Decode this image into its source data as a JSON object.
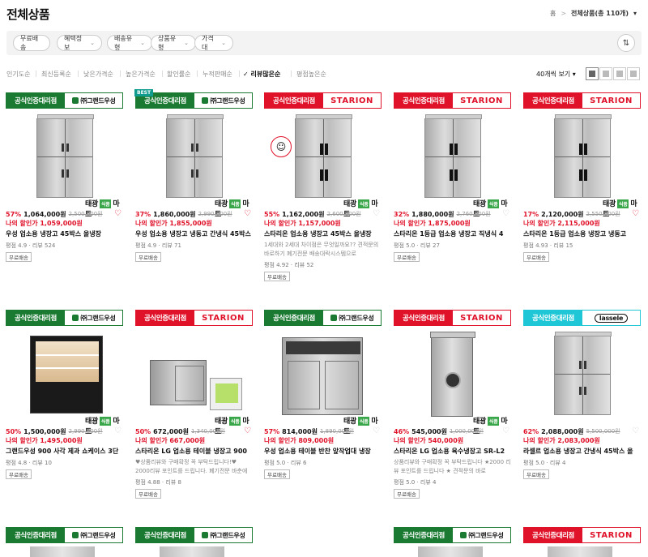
{
  "header": {
    "title": "전체상품",
    "breadcrumb": {
      "home": "홈",
      "sep": ">",
      "current": "전체상품(총 110개)",
      "caret": "▾"
    }
  },
  "filters": {
    "chips": [
      {
        "label": "무료배송",
        "caret": ""
      },
      {
        "label": "혜택정보",
        "caret": "⌄"
      },
      {
        "label": "배송유형",
        "caret": "⌄"
      },
      {
        "label": "상품유형",
        "caret": "⌄"
      },
      {
        "label": "가격대",
        "caret": "⌄"
      }
    ],
    "settings_icon": "⇅"
  },
  "sort": {
    "options": [
      "인기도순",
      "최신등록순",
      "낮은가격순",
      "높은가격순",
      "할인률순",
      "누적판매순",
      "리뷰많은순",
      "평점높은순"
    ],
    "active_check": "✓",
    "per_page": "40개씩 보기 ▾"
  },
  "products": [
    {
      "badge_left": "공식인증대리점",
      "badge_right": "㈜그랜드우성",
      "style": "green",
      "best": "",
      "discount": "57%",
      "price": "1,064,000원",
      "orig": "2,500,000원",
      "my_price": "나의 할인가 1,059,000원",
      "name": "우성 업소용 냉장고 45박스 올냉장",
      "desc": "",
      "rating": "평점 4.9 · 리뷰 524",
      "ship": "무료배송",
      "heart": "♡",
      "heart_on": true
    },
    {
      "badge_left": "공식인증대리점",
      "badge_right": "㈜그랜드우성",
      "style": "green",
      "best": "BEST",
      "discount": "37%",
      "price": "1,860,000원",
      "orig": "2,990,000원",
      "my_price": "나의 할인가 1,855,000원",
      "name": "우성 업소용 냉장고 냉동고 간냉식 45박스",
      "desc": "",
      "rating": "평점 4.9 · 리뷰 71",
      "ship": "무료배송",
      "heart": "♡",
      "heart_on": true
    },
    {
      "badge_left": "공식인증대리점",
      "badge_right": "STARION",
      "style": "red",
      "best": "",
      "discount": "55%",
      "price": "1,162,000원",
      "orig": "2,600,000원",
      "my_price": "나의 할인가 1,157,000원",
      "name": "스타리온 업소용 냉장고 45박스 올냉장",
      "desc": "1세대와 2세대 차이점은 무엇일까요?? 견적문의 바로하기 폐기전문 배송대락시스템으로",
      "rating": "평점 4.92 · 리뷰 52",
      "ship": "무료배송",
      "heart": "♡",
      "heart_on": false
    },
    {
      "badge_left": "공식인증대리점",
      "badge_right": "STARION",
      "style": "red",
      "best": "",
      "discount": "32%",
      "price": "1,880,000원",
      "orig": "2,760,000원",
      "my_price": "나의 할인가 1,875,000원",
      "name": "스타리온 1등급 업소용 냉장고 직냉식 4",
      "desc": "",
      "rating": "평점 5.0 · 리뷰 27",
      "ship": "무료배송",
      "heart": "♡",
      "heart_on": false
    },
    {
      "badge_left": "공식인증대리점",
      "badge_right": "STARION",
      "style": "red",
      "best": "",
      "discount": "17%",
      "price": "2,120,000원",
      "orig": "2,550,000원",
      "my_price": "나의 할인가 2,115,000원",
      "name": "스타리온 1등급 업소용 냉장고 냉동고",
      "desc": "",
      "rating": "평점 4.93 · 리뷰 15",
      "ship": "무료배송",
      "heart": "♡",
      "heart_on": true
    },
    {
      "badge_left": "공식인증대리점",
      "badge_right": "㈜그랜드우성",
      "style": "green",
      "best": "",
      "discount": "50%",
      "price": "1,500,000원",
      "orig": "2,990,000원",
      "my_price": "나의 할인가 1,495,000원",
      "name": "그랜드우성 900 사각 제과 쇼케이스 3단",
      "desc": "",
      "rating": "평점 4.8 · 리뷰 10",
      "ship": "무료배송",
      "heart": "♡",
      "heart_on": false
    },
    {
      "badge_left": "공식인증대리점",
      "badge_right": "STARION",
      "style": "red",
      "best": "",
      "discount": "50%",
      "price": "672,000원",
      "orig": "1,340,000원",
      "my_price": "나의 할인가 667,000원",
      "name": "스타리온 LG 업소용 테이블 냉장고 900",
      "desc": "♥상품리뷰와 구매확정 꼭 부탁드립니다!♥ 2000리뷰 포인트를 드립니다. 폐기전문 바춘에",
      "rating": "평점 4.88 · 리뷰 8",
      "ship": "무료배송",
      "heart": "♡",
      "heart_on": true
    },
    {
      "badge_left": "공식인증대리점",
      "badge_right": "㈜그랜드우성",
      "style": "green",
      "best": "",
      "discount": "57%",
      "price": "814,000원",
      "orig": "1,890,000원",
      "my_price": "나의 할인가 809,000원",
      "name": "우성 업소용 테이블 반찬 앞작업대 냉장",
      "desc": "",
      "rating": "평점 5.0 · 리뷰 6",
      "ship": "무료배송",
      "heart": "♡",
      "heart_on": false
    },
    {
      "badge_left": "공식인증대리점",
      "badge_right": "STARION",
      "style": "red",
      "best": "",
      "discount": "46%",
      "price": "545,000원",
      "orig": "1,000,000원",
      "my_price": "나의 할인가 540,000원",
      "name": "스타리온 LG 업소용 육수냉장고 SR-L2",
      "desc": "상품리뷰와 구매확정 꼭 부탁드립니다 ★2000 리뷰 포인트를 드립니다 ★ 견적문의 바로",
      "rating": "평점 5.0 · 리뷰 4",
      "ship": "무료배송",
      "heart": "♡",
      "heart_on": false
    },
    {
      "badge_left": "공식인증대리점",
      "badge_right": "lassele",
      "style": "teal",
      "best": "",
      "discount": "62%",
      "price": "2,088,000원",
      "orig": "5,500,000원",
      "my_price": "나의 할인가 2,083,000원",
      "name": "라셀르 업소용 냉장고 간냉식 45박스 올",
      "desc": "",
      "rating": "평점 5.0 · 리뷰 4",
      "ship": "무료배송",
      "heart": "♡",
      "heart_on": false
    },
    {
      "badge_left": "공식인증대리점",
      "badge_right": "㈜그랜드우성",
      "style": "green"
    },
    {
      "badge_left": "공식인증대리점",
      "badge_right": "㈜그랜드우성",
      "style": "green"
    },
    {
      "badge_left": "",
      "badge_right": "",
      "style": "none"
    },
    {
      "badge_left": "공식인증대리점",
      "badge_right": "㈜그랜드우성",
      "style": "green"
    },
    {
      "badge_left": "공식인증대리점",
      "badge_right": "STARION",
      "style": "red"
    }
  ],
  "shop_logo": {
    "a": "태광",
    "g": "식품",
    "b": "마트"
  }
}
